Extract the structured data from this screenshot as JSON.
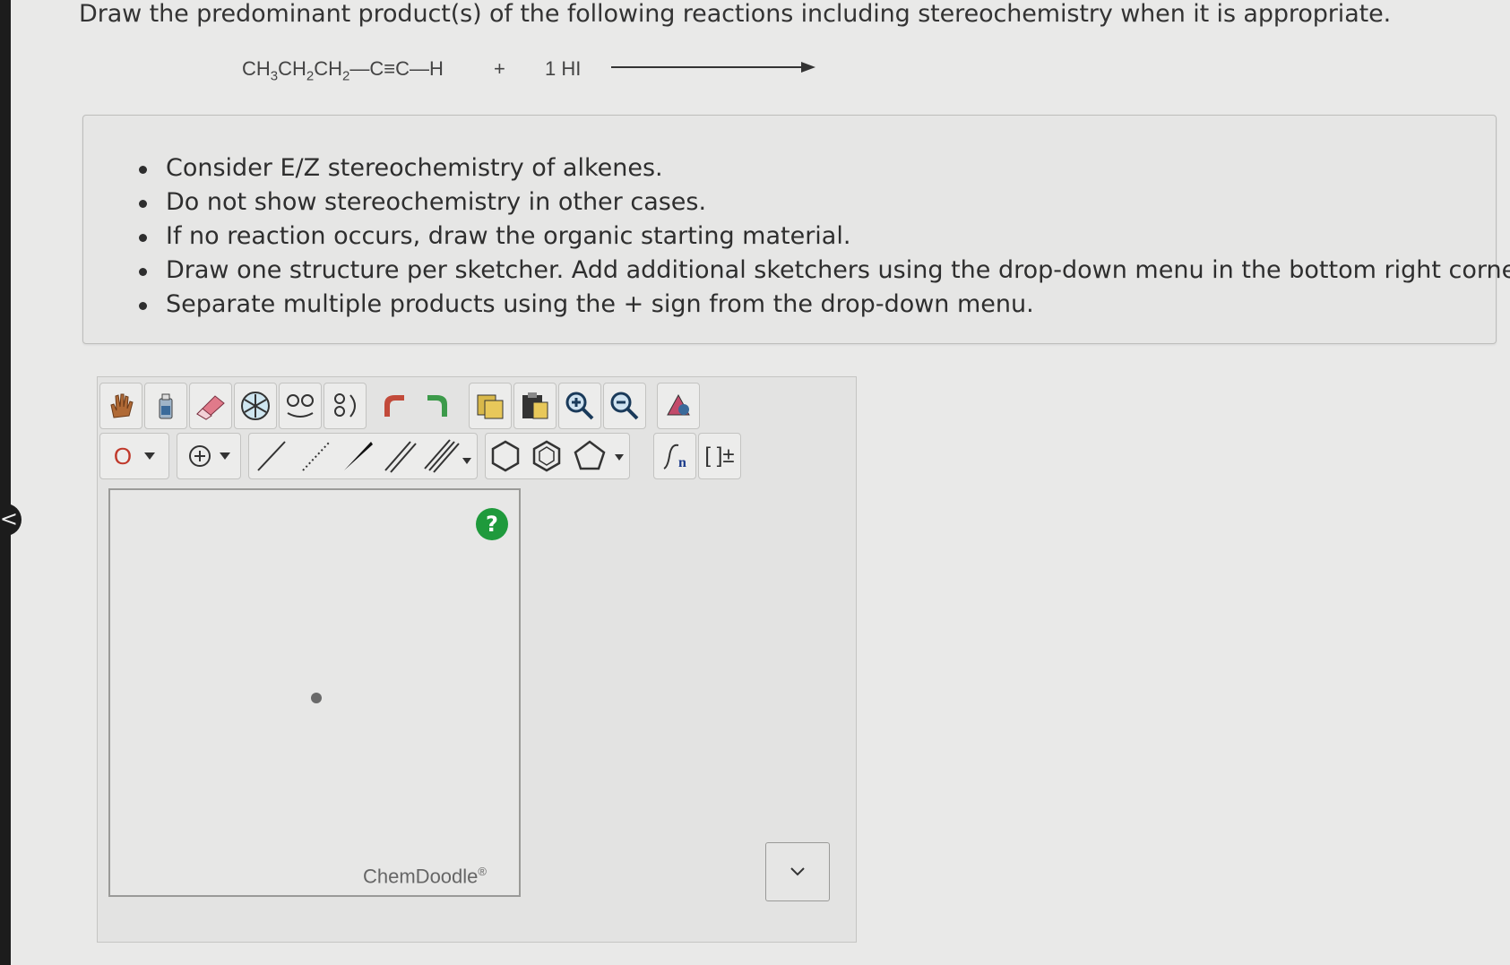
{
  "question": "Draw the predominant product(s) of the following reactions including stereochemistry when it is appropriate.",
  "reaction": {
    "reactant_main": "CH",
    "reactant_sub1": "3",
    "reactant_mid1": "CH",
    "reactant_sub2": "2",
    "reactant_mid2": "CH",
    "reactant_sub3": "2",
    "reactant_tail": "—C≡C—H",
    "plus": "+",
    "reagent": "1 HI"
  },
  "instructions": [
    "Consider E/Z stereochemistry of alkenes.",
    "Do not show stereochemistry in other cases.",
    "If no reaction occurs, draw the organic starting material.",
    "Draw one structure per sketcher. Add additional sketchers using the drop-down menu in the bottom right corner.",
    "Separate multiple products using the + sign from the drop-down menu."
  ],
  "toolbar": {
    "atom_label": "O",
    "bracket_label": "[ ]±",
    "sgroup_sub": "n"
  },
  "canvas": {
    "help": "?",
    "watermark": "ChemDoodle",
    "watermark_mark": "®"
  },
  "nav": {
    "left_tab": "<"
  },
  "icons": {
    "hand": "hand-icon",
    "bottle": "clear-icon",
    "eraser": "eraser-icon",
    "ring-template": "template-icon",
    "undo": "undo-icon",
    "redo": "redo-icon",
    "zoom-in": "zoom-in-icon",
    "zoom-out": "zoom-out-icon",
    "dropdown": "chevron-down-icon"
  },
  "colors": {
    "help_green": "#1f9a3c",
    "eraser_pink": "#e07a8a",
    "undo_red": "#c24a3a",
    "redo_green": "#3c9a4a"
  }
}
